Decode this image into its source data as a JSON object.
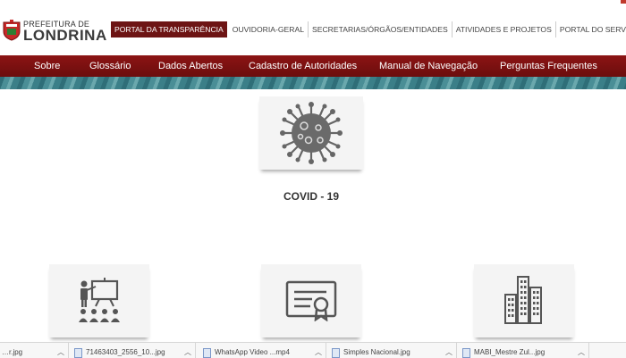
{
  "logo": {
    "line1": "PREFEITURA DE",
    "line2": "LONDRINA"
  },
  "top_nav": [
    {
      "label": "PORTAL DA TRANSPARÊNCIA",
      "active": true
    },
    {
      "label": "OUVIDORIA-GERAL"
    },
    {
      "label": "SECRETARIAS/ÓRGÃOS/ENTIDADES"
    },
    {
      "label": "ATIVIDADES E PROJETOS"
    },
    {
      "label": "PORTAL DO SERVIDOR"
    }
  ],
  "main_nav": [
    "Sobre",
    "Glossário",
    "Dados Abertos",
    "Cadastro de Autoridades",
    "Manual de Navegação",
    "Perguntas Frequentes"
  ],
  "featured": {
    "label": "COVID - 19",
    "icon": "virus-icon"
  },
  "cards": [
    {
      "icon": "presentation-audience-icon"
    },
    {
      "icon": "certificate-icon"
    },
    {
      "icon": "city-buildings-icon"
    }
  ],
  "downloads": [
    {
      "name": "…r.jpg"
    },
    {
      "name": "71463403_2556_10...jpg"
    },
    {
      "name": "WhatsApp Video ...mp4"
    },
    {
      "name": "Simples Nacional.jpg"
    },
    {
      "name": "MABI_Mestre Zul...jpg"
    }
  ],
  "colors": {
    "brand": "#7a1010",
    "nav_text": "#ffffff",
    "card_bg": "#f4f4f4"
  }
}
